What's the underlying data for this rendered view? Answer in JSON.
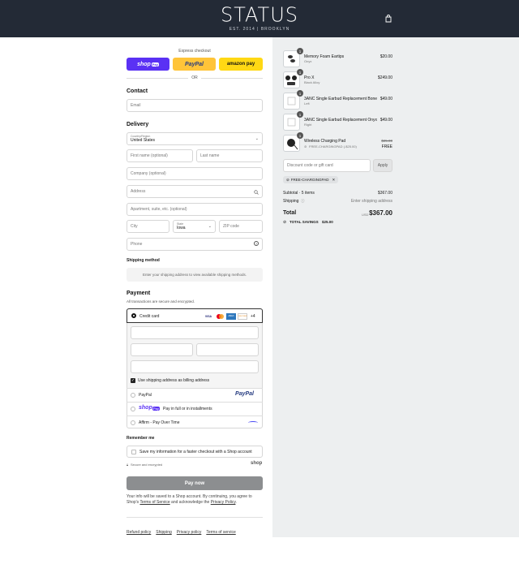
{
  "brand": {
    "logo": "STATUS",
    "tagline": "EST. 2014  |  BROOKLYN"
  },
  "express": {
    "label": "Express checkout",
    "shop": "shop",
    "shop_pay": "Pay",
    "paypal": "PayPal",
    "amazon": "amazon pay",
    "or": "OR"
  },
  "contact": {
    "title": "Contact",
    "email_placeholder": "Email"
  },
  "delivery": {
    "title": "Delivery",
    "country_label": "Country/Region",
    "country": "United States",
    "first_name": "First name (optional)",
    "last_name": "Last name",
    "company": "Company (optional)",
    "address": "Address",
    "apartment": "Apartment, suite, etc. (optional)",
    "city": "City",
    "state_label": "State",
    "state": "Iowa",
    "zip": "ZIP code",
    "phone": "Phone"
  },
  "shipping": {
    "title": "Shipping method",
    "note": "Enter your shipping address to view available shipping methods."
  },
  "payment": {
    "title": "Payment",
    "subtitle": "All transactions are secure and encrypted.",
    "credit_card": "Credit card",
    "more_cards": "+4",
    "billing": "Use shipping address as billing address",
    "paypal": "PayPal",
    "shoppay_text": "Pay in full or in installments",
    "affirm": "Affirm - Pay Over Time",
    "card_icons": [
      "VISA",
      "MC",
      "AMEX",
      "DISCOVER"
    ]
  },
  "remember": {
    "title": "Remember me",
    "checkbox": "Save my information for a faster checkout with a Shop account",
    "secure": "Secure and encrypted",
    "shop": "shop"
  },
  "paynow": "Pay now",
  "legal": {
    "text1": "Your info will be saved to a Shop account. By continuing, you agree to Shop's ",
    "terms": "Terms of Service",
    "text2": " and acknowledge the ",
    "privacy": "Privacy Policy",
    "text3": "."
  },
  "footer": [
    "Refund policy",
    "Shipping",
    "Privacy policy",
    "Terms of service"
  ],
  "cart": {
    "items": [
      {
        "qty": "1",
        "name": "Memory Foam Eartips",
        "variant": "Onyx",
        "price": "$20.00"
      },
      {
        "qty": "1",
        "name": "Pro X",
        "variant": "Black Alloy",
        "price": "$249.00"
      },
      {
        "qty": "1",
        "name": "3ANC Single Earbud Replacement Bone",
        "variant": "Left",
        "price": "$49.00"
      },
      {
        "qty": "1",
        "name": "3ANC Single Earbud Replacement Onyx",
        "variant": "Right",
        "price": "$49.00"
      },
      {
        "qty": "1",
        "name": "Wireless Charging Pad",
        "variant": "FREE-CHARGINGPAD (-$25.00)",
        "old_price": "$25.00",
        "price": "FREE"
      }
    ],
    "discount_placeholder": "Discount code or gift card",
    "apply": "Apply",
    "applied_code": "FREE-CHARGINGPAD",
    "subtotal_label": "Subtotal · 5 items",
    "subtotal": "$367.00",
    "shipping_label": "Shipping",
    "shipping_value": "Enter shipping address",
    "total_label": "Total",
    "currency": "USD",
    "total": "$367.00",
    "savings_label": "TOTAL SAVINGS",
    "savings": "$25.00"
  }
}
